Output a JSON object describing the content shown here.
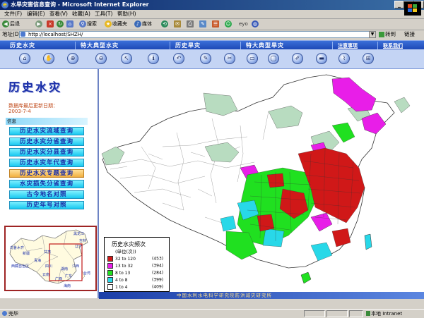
{
  "window": {
    "title": "水旱灾害信息查询 - Microsoft Internet Explorer",
    "ie_glyph": "e"
  },
  "menubar": {
    "items": [
      "文件(F)",
      "编辑(E)",
      "查看(V)",
      "收藏(A)",
      "工具(T)",
      "帮助(H)"
    ]
  },
  "toolbar": {
    "back": "后退",
    "search": "搜索",
    "favorites": "收藏夹",
    "media": "媒体",
    "misc": "eyo"
  },
  "address": {
    "label": "地址(D)",
    "url": "http://localhost/SHZH/",
    "go": "转到",
    "links": "链接"
  },
  "nav": {
    "items": [
      "历史水灾",
      "特大典型水灾",
      "历史旱灾",
      "特大典型旱灾",
      "注意事项",
      "联系我们"
    ]
  },
  "tools": {
    "glyphs": [
      "⌂",
      "✋",
      "⊕",
      "⊖",
      "↖",
      "ℹ",
      "↶",
      "✎",
      "✂",
      "▭",
      "◯",
      "✐",
      "▬",
      "⌇",
      "⊞"
    ]
  },
  "left": {
    "title": "历史水灾",
    "update_label": "数据库最后更新日期：",
    "update_date": "2003-7-4",
    "section_header": "信息",
    "queries": [
      "历史水灾流域查询",
      "历史水灾分省查询",
      "历史水灾分县查询",
      "历史水灾年代查询",
      "历史水灾专题查询",
      "水灾损失分省查询",
      "古今地名对照",
      "历史年号对照"
    ],
    "active_index": 4,
    "minimap_labels": [
      "黑龙江",
      "吉林",
      "辽宁",
      "乌鲁木齐",
      "新疆",
      "甘肃",
      "西藏自治区",
      "青海",
      "四川",
      "云南",
      "广西",
      "广东",
      "湖南",
      "江西",
      "台湾",
      "海南"
    ]
  },
  "legend": {
    "title": "历史水灾频次",
    "unit": "(单位(次))",
    "rows": [
      {
        "range": "32 to 120",
        "count": "(453)",
        "color": "#d01818"
      },
      {
        "range": "13 to 32",
        "count": "(394)",
        "color": "#e81ee8"
      },
      {
        "range": "8 to 13",
        "count": "(284)",
        "color": "#20e020"
      },
      {
        "range": "4 to 8",
        "count": "(399)",
        "color": "#28d8e8"
      },
      {
        "range": "1 to 4",
        "count": "(409)",
        "color": "#ffffff"
      }
    ]
  },
  "footer": {
    "text": "中国水利水电科学研究院防洪减灾研究所"
  },
  "status": {
    "left": "完毕",
    "zone": "本地 Intranet"
  },
  "colors": {
    "title_bar": "#0a246a",
    "nav_bar": "#2a55c8",
    "query_button": "#18c8f0",
    "active_button": "#f2b040",
    "accent_text": "#1a2ea8"
  }
}
